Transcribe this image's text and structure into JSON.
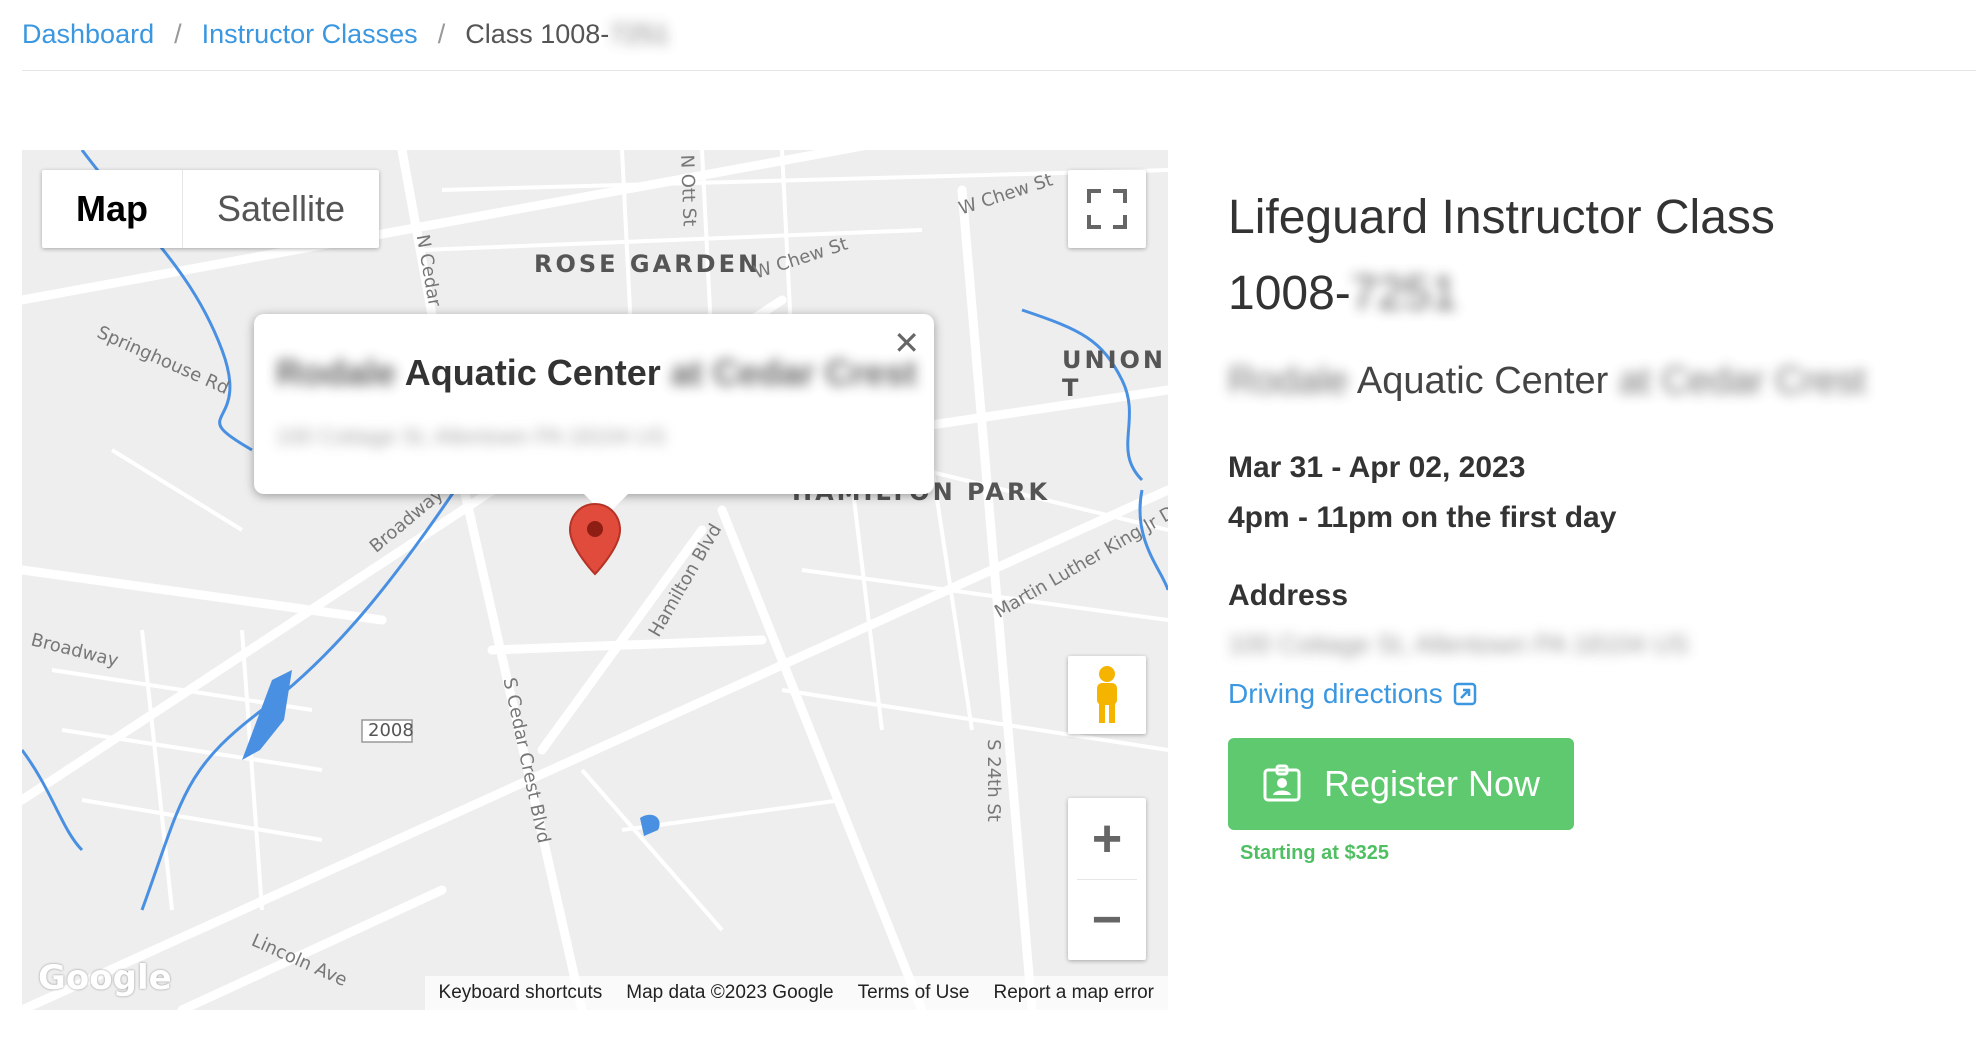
{
  "breadcrumb": {
    "items": [
      "Dashboard",
      "Instructor Classes"
    ],
    "current_prefix": "Class 1008-",
    "current_redacted": "7251"
  },
  "map": {
    "type_buttons": [
      "Map",
      "Satellite"
    ],
    "labels": {
      "rose_garden": "ROSE GARDEN",
      "union": "UNION T",
      "hamilton_park": "HAMILTON PARK"
    },
    "streets": [
      "W Chew St",
      "W Chew St",
      "N Ott St",
      "Springhouse Rd",
      "Broadway",
      "Broadway",
      "S Cedar Crest Blvd",
      "Hamilton Blvd",
      "Martin Luther King Jr Dr",
      "S 24th St",
      "Lincoln Ave",
      "2008",
      "N Cedar"
    ],
    "info_window": {
      "name_prefix": "Rodale",
      "name_visible": "Aquatic Center",
      "name_suffix": "at Cedar Crest",
      "address": "100 Cottage St, Allentown PA 18104 US"
    },
    "footer": [
      "Keyboard shortcuts",
      "Map data ©2023 Google",
      "Terms of Use",
      "Report a map error"
    ],
    "logo": "Google"
  },
  "class": {
    "title_line1": "Lifeguard Instructor Class",
    "title_line2_prefix": "1008-",
    "title_line2_redacted": "7251",
    "venue_prefix": "Rodale",
    "venue_visible": "Aquatic Center",
    "venue_suffix": "at Cedar Crest",
    "dates": "Mar 31 - Apr 02, 2023",
    "time": "4pm - 11pm on the first day",
    "address_label": "Address",
    "address_value": "100 Cottage St, Allentown PA 18104 US",
    "directions_label": "Driving directions",
    "register_label": "Register Now",
    "price_text": "Starting at $325"
  },
  "colors": {
    "link": "#3a97e0",
    "register": "#5ec96e",
    "water": "#4a90e2",
    "pin": "#e04b3c"
  }
}
